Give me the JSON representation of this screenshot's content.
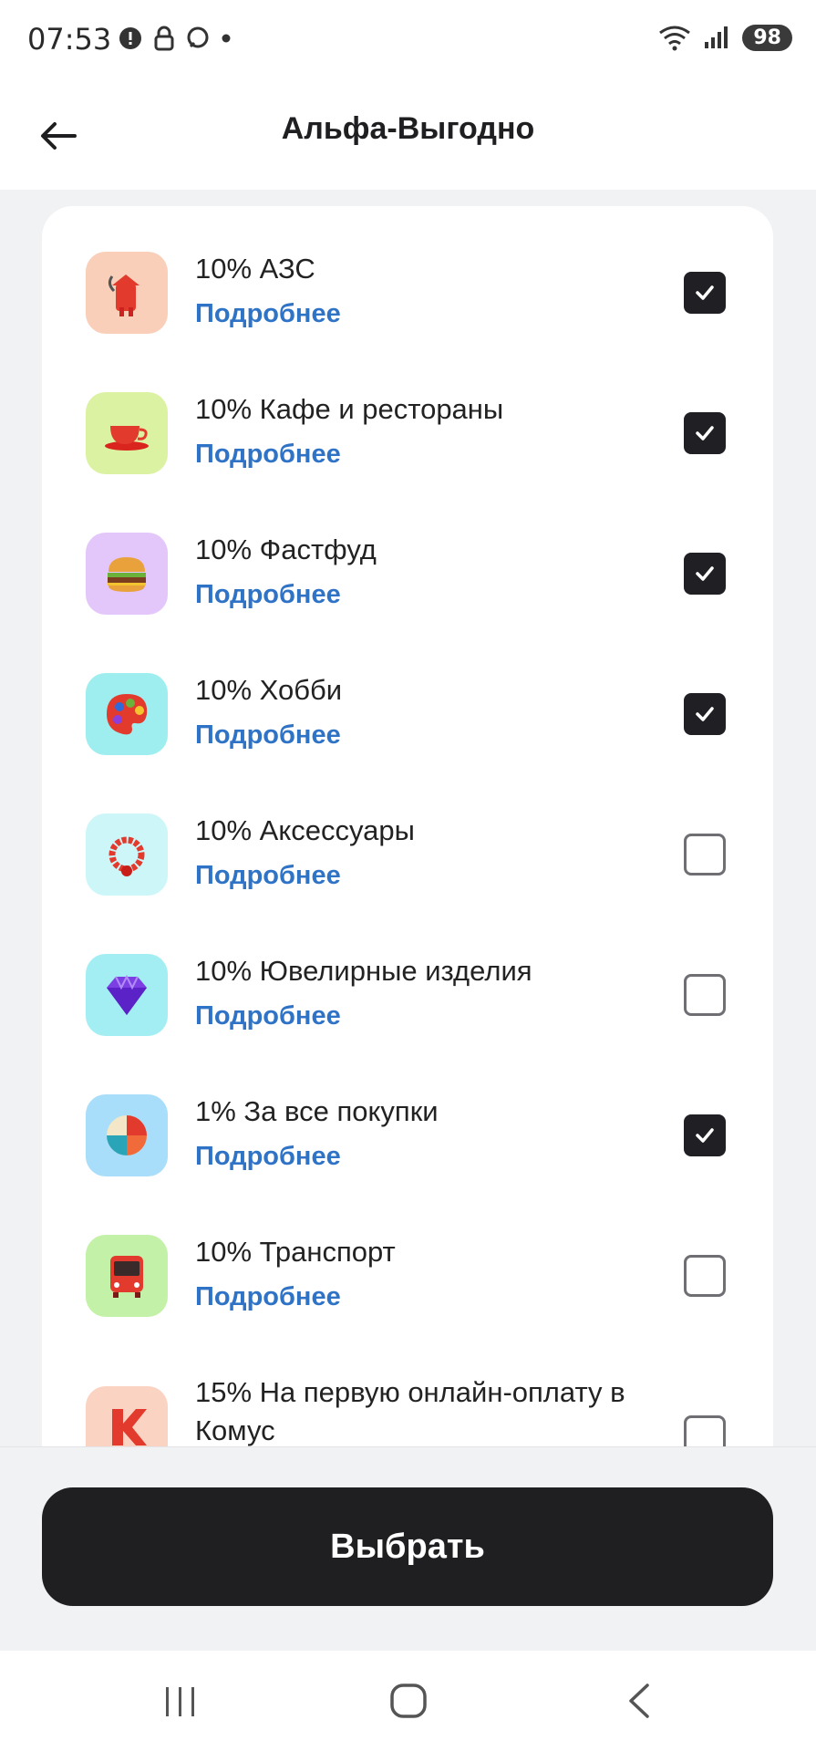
{
  "status_bar": {
    "time": "07:53",
    "battery": "98",
    "left_icons": [
      "alert-icon",
      "lock-icon",
      "chat-icon",
      "dot-icon"
    ],
    "right_icons": [
      "wifi-icon",
      "signal-icon"
    ]
  },
  "header": {
    "title": "Альфа-Выгодно",
    "back_icon": "arrow-left-icon"
  },
  "categories": [
    {
      "title": "10% АЗС",
      "link": "Подробнее",
      "checked": true,
      "icon": "fuel-pump-icon",
      "icon_bg": "#f9cfb9"
    },
    {
      "title": "10% Кафе и рестораны",
      "link": "Подробнее",
      "checked": true,
      "icon": "coffee-cup-icon",
      "icon_bg": "#dcf2a3"
    },
    {
      "title": "10% Фастфуд",
      "link": "Подробнее",
      "checked": true,
      "icon": "burger-icon",
      "icon_bg": "#e3c6fa"
    },
    {
      "title": "10% Хобби",
      "link": "Подробнее",
      "checked": true,
      "icon": "palette-icon",
      "icon_bg": "#9eeef0"
    },
    {
      "title": "10% Аксессуары",
      "link": "Подробнее",
      "checked": false,
      "icon": "bead-bracelet-icon",
      "icon_bg": "#cdf6f8"
    },
    {
      "title": "10% Ювелирные изделия",
      "link": "Подробнее",
      "checked": false,
      "icon": "gem-icon",
      "icon_bg": "#a3eef2"
    },
    {
      "title": "1% За все покупки",
      "link": "Подробнее",
      "checked": true,
      "icon": "pie-icon",
      "icon_bg": "#a8def9"
    },
    {
      "title": "10% Транспорт",
      "link": "Подробнее",
      "checked": false,
      "icon": "bus-icon",
      "icon_bg": "#c4f1a8"
    },
    {
      "title": "15% На первую онлайн-оплату в Комус",
      "link": "",
      "checked": false,
      "icon": "komus-logo-icon",
      "icon_bg": "#fbd3c3"
    }
  ],
  "actions": {
    "select_label": "Выбрать"
  },
  "nav_bar": {
    "items": [
      "recent-apps-icon",
      "home-icon",
      "back-icon"
    ]
  },
  "colors": {
    "accent_link": "#2f73c7",
    "checkbox_on": "#202024",
    "button_bg": "#1f1f22"
  }
}
